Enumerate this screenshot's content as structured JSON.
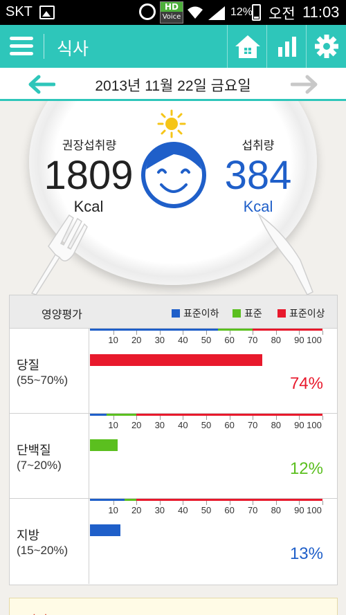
{
  "status_bar": {
    "carrier": "SKT",
    "hd_voice_top": "HD",
    "hd_voice_bottom": "Voice",
    "battery": "12%",
    "ampm": "오전",
    "time": "11:03"
  },
  "header": {
    "title": "식사",
    "icons": [
      "menu-icon",
      "home-icon",
      "bar-chart-icon",
      "gear-icon"
    ]
  },
  "date_bar": {
    "date": "2013년 11월 22일 금요일",
    "prev_icon": "arrow-left-icon",
    "next_icon": "arrow-right-icon"
  },
  "summary": {
    "recommended_label": "권장섭취량",
    "recommended_value": "1809",
    "recommended_unit": "Kcal",
    "intake_label": "섭취량",
    "intake_value": "384",
    "intake_unit": "Kcal",
    "mood": "smiling-face",
    "time_of_day": "sun-icon"
  },
  "nutrition": {
    "title": "영양평가",
    "legend": [
      {
        "label": "표준이하",
        "color": "#1f5fc9"
      },
      {
        "label": "표준",
        "color": "#5bbf1f"
      },
      {
        "label": "표준이상",
        "color": "#e8192c"
      }
    ],
    "scale_ticks": [
      "10",
      "20",
      "30",
      "40",
      "50",
      "60",
      "70",
      "80",
      "90",
      "100"
    ],
    "rows": [
      {
        "name": "당질",
        "range": "(55~70%)",
        "value": 74,
        "display": "74%",
        "status_color": "#e8192c",
        "std_low": 55,
        "std_high": 70
      },
      {
        "name": "단백질",
        "range": "(7~20%)",
        "value": 12,
        "display": "12%",
        "status_color": "#5bbf1f",
        "std_low": 7,
        "std_high": 20
      },
      {
        "name": "지방",
        "range": "(15~20%)",
        "value": 13,
        "display": "13%",
        "status_color": "#1f5fc9",
        "std_low": 15,
        "std_high": 20
      }
    ]
  },
  "bottom_card": {
    "label": "의견"
  },
  "colors": {
    "accent": "#2ec6ba",
    "below": "#1f5fc9",
    "normal": "#5bbf1f",
    "above": "#e8192c"
  }
}
